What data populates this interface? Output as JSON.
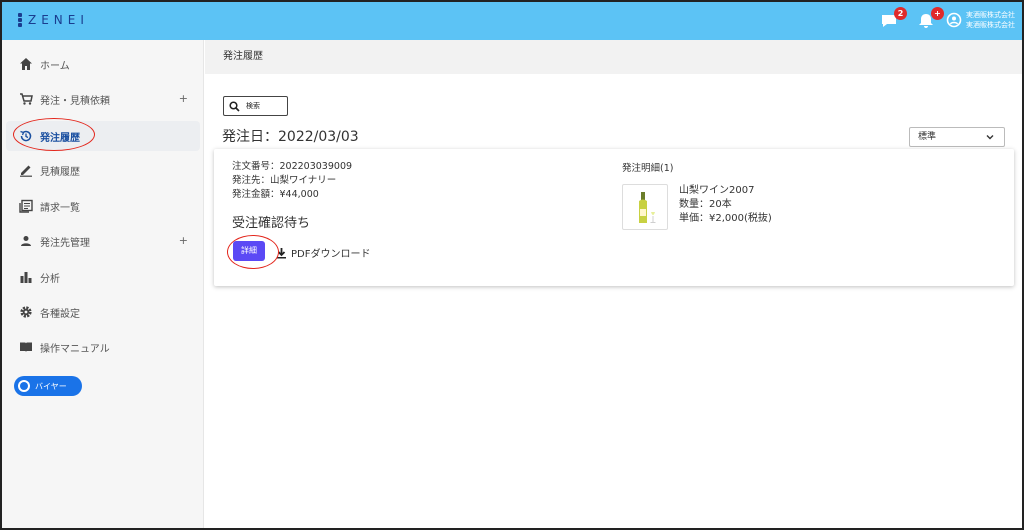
{
  "app": {
    "logo_text": "ZENEI",
    "brand_color": "#5cc3f5"
  },
  "topbar": {
    "messages_badge": "2",
    "notifications_badge": "+",
    "account_name_line1": "実酒販株式会社",
    "account_name_line2": "実酒販株式会社"
  },
  "sidebar": {
    "items": [
      {
        "label": "ホーム",
        "icon": "home-icon"
      },
      {
        "label": "発注・見積依頼",
        "icon": "cart-icon",
        "expand": "+"
      },
      {
        "label": "発注履歴",
        "icon": "history-icon",
        "active": true
      },
      {
        "label": "見積履歴",
        "icon": "pencil-icon"
      },
      {
        "label": "請求一覧",
        "icon": "document-list-icon"
      },
      {
        "label": "発注先管理",
        "icon": "person-icon",
        "expand": "+"
      },
      {
        "label": "分析",
        "icon": "bar-chart-icon"
      },
      {
        "label": "各種設定",
        "icon": "gear-icon"
      },
      {
        "label": "操作マニュアル",
        "icon": "book-icon"
      }
    ],
    "role_badge": "バイヤー"
  },
  "main": {
    "page_title": "発注履歴",
    "search_label": "検索",
    "date_heading": "発注日：2022/03/03",
    "sort_value": "標準",
    "order": {
      "number": "注文番号：202203039009",
      "supplier": "発注先：山梨ワイナリー",
      "amount": "発注金額：¥44,000",
      "status": "受注確認待ち",
      "detail_button": "詳細",
      "pdf_link": "PDFダウンロード",
      "detail_heading": "発注明細(1)",
      "product": {
        "name": "山梨ワイン2007",
        "quantity": "数量：20本",
        "unit_price": "単価：¥2,000(税抜)"
      }
    }
  },
  "colors": {
    "detail_button": "#5b49f5",
    "annotation": "#e3261c",
    "badge": "#e02a2a",
    "role_badge": "#1a73e8"
  }
}
